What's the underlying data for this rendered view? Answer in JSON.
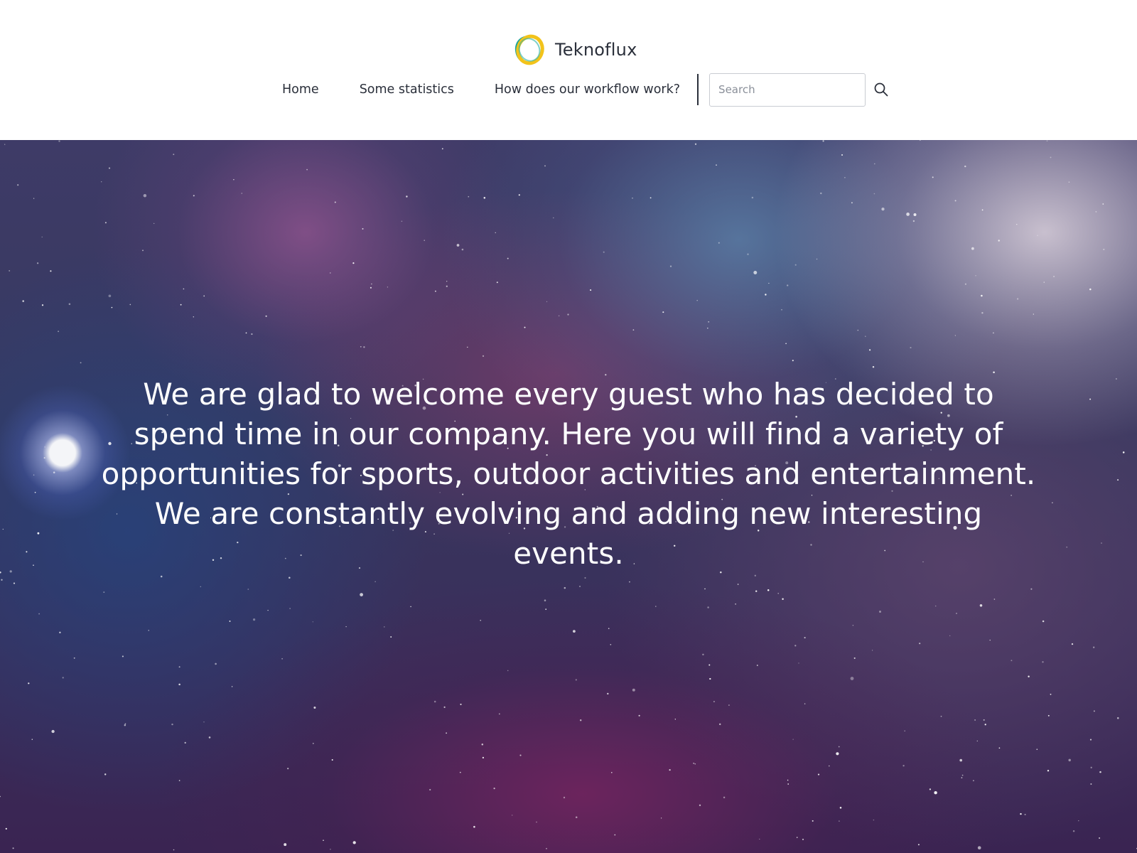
{
  "brand": {
    "name": "Teknoflux",
    "logo_icon": "ring-logo-icon",
    "logo_colors": [
      "#1fa59a",
      "#f2c31b"
    ]
  },
  "nav": {
    "items": [
      {
        "label": "Home"
      },
      {
        "label": "Some statistics"
      },
      {
        "label": "How does our workflow work?"
      }
    ],
    "search": {
      "placeholder": "Search",
      "value": "",
      "icon": "search-icon"
    }
  },
  "hero": {
    "text": "We are glad to welcome every guest who has decided to spend time in our company. Here you will find a variety of opportunities for sports, outdoor activities and entertainment. We are constantly evolving and adding new interesting events.",
    "background": "space-nebula-image"
  },
  "colors": {
    "text": "#2a2f3a",
    "header_bg": "#ffffff",
    "hero_text": "#ffffff"
  }
}
